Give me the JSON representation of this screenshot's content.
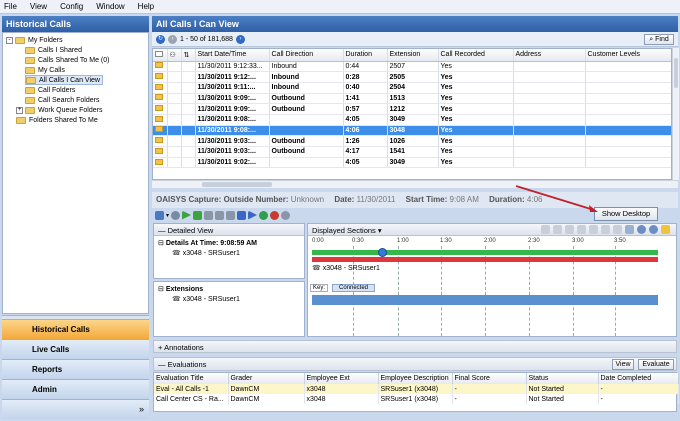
{
  "menu": [
    "File",
    "View",
    "Config",
    "Window",
    "Help"
  ],
  "left_panel": {
    "title": "Historical Calls",
    "tree": [
      {
        "label": "My Folders",
        "level": 0,
        "expander": "-"
      },
      {
        "label": "Calls I Shared",
        "level": 1
      },
      {
        "label": "Calls Shared To Me (0)",
        "level": 1
      },
      {
        "label": "My Calls",
        "level": 1
      },
      {
        "label": "All Calls I Can View",
        "level": 1,
        "selected": true
      },
      {
        "label": "Call Folders",
        "level": 1
      },
      {
        "label": "Call Search Folders",
        "level": 1
      },
      {
        "label": "Work Queue Folders",
        "level": 1,
        "expander": "+"
      },
      {
        "label": "Folders Shared To Me",
        "level": 0
      }
    ],
    "nav": [
      "Historical Calls",
      "Live Calls",
      "Reports",
      "Admin"
    ],
    "collapse_glyph": "»"
  },
  "main": {
    "title": "All Calls I Can View",
    "pager_text": "1 - 50 of 181,688",
    "find_label": "Find",
    "columns": [
      "Start Date/Time",
      "Call Direction",
      "Duration",
      "Extension",
      "Call Recorded",
      "Address",
      "Customer Levels"
    ],
    "rows": [
      {
        "start": "11/30/2011 9:12:33...",
        "dir": "Inbound",
        "dur": "0:44",
        "ext": "2507",
        "rec": "Yes",
        "bold": false
      },
      {
        "start": "11/30/2011 9:12:...",
        "dir": "Inbound",
        "dur": "0:28",
        "ext": "2505",
        "rec": "Yes",
        "bold": true
      },
      {
        "start": "11/30/2011 9:11:...",
        "dir": "Inbound",
        "dur": "0:40",
        "ext": "2504",
        "rec": "Yes",
        "bold": true
      },
      {
        "start": "11/30/2011 9:09:...",
        "dir": "Outbound",
        "dur": "1:41",
        "ext": "1513",
        "rec": "Yes",
        "bold": true
      },
      {
        "start": "11/30/2011 9:09:...",
        "dir": "Outbound",
        "dur": "0:57",
        "ext": "1212",
        "rec": "Yes",
        "bold": true
      },
      {
        "start": "11/30/2011 9:08:...",
        "dir": "",
        "dur": "4:05",
        "ext": "3049",
        "rec": "Yes",
        "bold": true
      },
      {
        "start": "11/30/2011 9:08:...",
        "dir": "",
        "dur": "4:06",
        "ext": "3048",
        "rec": "Yes",
        "bold": true,
        "selected": true
      },
      {
        "start": "11/30/2011 9:03:...",
        "dir": "Outbound",
        "dur": "1:26",
        "ext": "1026",
        "rec": "Yes",
        "bold": true
      },
      {
        "start": "11/30/2011 9:03:...",
        "dir": "Outbound",
        "dur": "4:17",
        "ext": "1541",
        "rec": "Yes",
        "bold": true
      },
      {
        "start": "11/30/2011 9:02:...",
        "dir": "",
        "dur": "4:05",
        "ext": "3049",
        "rec": "Yes",
        "bold": true
      }
    ]
  },
  "capture": {
    "title": "OAISYS Capture:",
    "outside_label": "Outside Number:",
    "outside_value": "Unknown",
    "date_label": "Date:",
    "date_value": "11/30/2011",
    "start_label": "Start Time:",
    "start_value": "9:08 AM",
    "duration_label": "Duration:",
    "duration_value": "4:06",
    "show_desktop": "Show Desktop",
    "detailed_view": "Detailed View",
    "displayed_sections": "Displayed Sections",
    "details_at": "Details At Time: 9:08:59 AM",
    "participant": "x3048 - SRSuser1",
    "extensions_label": "Extensions",
    "key_label": "Key:",
    "connected_label": "Connected",
    "ticks": [
      "0:00",
      "0:30",
      "1:00",
      "1:30",
      "2:00",
      "2:30",
      "3:00",
      "3:50"
    ],
    "annotations": "Annotations",
    "evaluations": "Evaluations",
    "view_btn": "View",
    "evaluate_btn": "Evaluate"
  },
  "eval_table": {
    "columns": [
      "Evaluation Title",
      "Grader",
      "Employee Ext",
      "Employee Description",
      "Final Score",
      "Status",
      "Date Completed"
    ],
    "rows": [
      [
        "Eval - All Calls -1",
        "DawnCM",
        "x3048",
        "SRSuser1 (x3048)",
        "-",
        "Not Started",
        "-"
      ],
      [
        "Call Center CS - Ra...",
        "DawnCM",
        "x3048",
        "SRSuser1 (x3048)",
        "-",
        "Not Started",
        "-"
      ]
    ]
  },
  "colors": {
    "accent": "#2f5fa6",
    "selection": "#3d8ee9",
    "active_nav": "#f3a93b",
    "arrow": "#c0212b"
  }
}
